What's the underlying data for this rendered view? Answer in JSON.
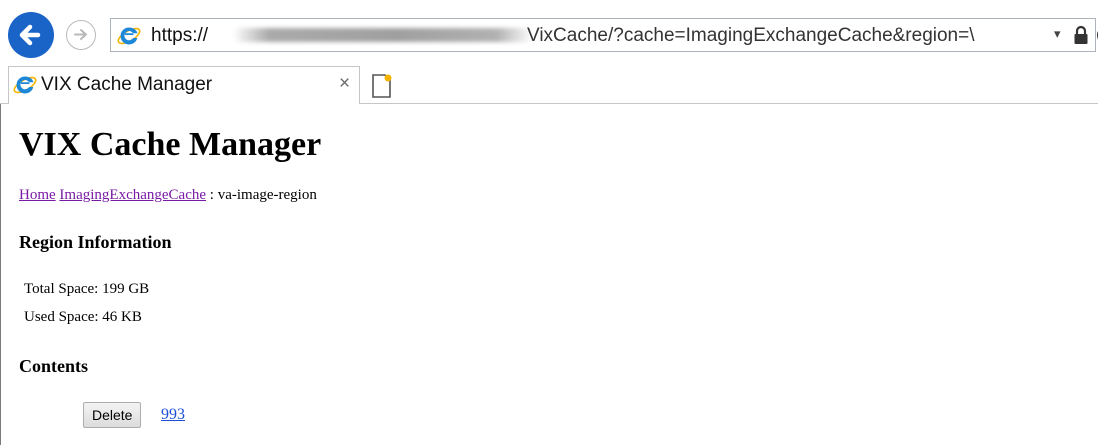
{
  "browser": {
    "address": {
      "scheme": "https://",
      "path": "VixCache/?cache=ImagingExchangeCache&region=\\"
    },
    "dropdown_glyph": "▾",
    "tab": {
      "title": "VIX Cache Manager",
      "close_glyph": "×"
    },
    "colors": {
      "back_button": "#1a64c8",
      "ie_icon": "#1e88d8"
    }
  },
  "page": {
    "title": "VIX Cache Manager",
    "breadcrumb": {
      "home": "Home",
      "cache": "ImagingExchangeCache",
      "separator": " : ",
      "current": "va-image-region"
    },
    "region_heading": "Region Information",
    "total_space": "Total Space: 199 GB",
    "used_space": "Used Space: 46 KB",
    "contents_heading": "Contents",
    "items": [
      {
        "button_label": "Delete",
        "link_label": "993"
      }
    ],
    "colors": {
      "visited_link": "#7a1aa6",
      "link": "#1a4fd6"
    }
  }
}
